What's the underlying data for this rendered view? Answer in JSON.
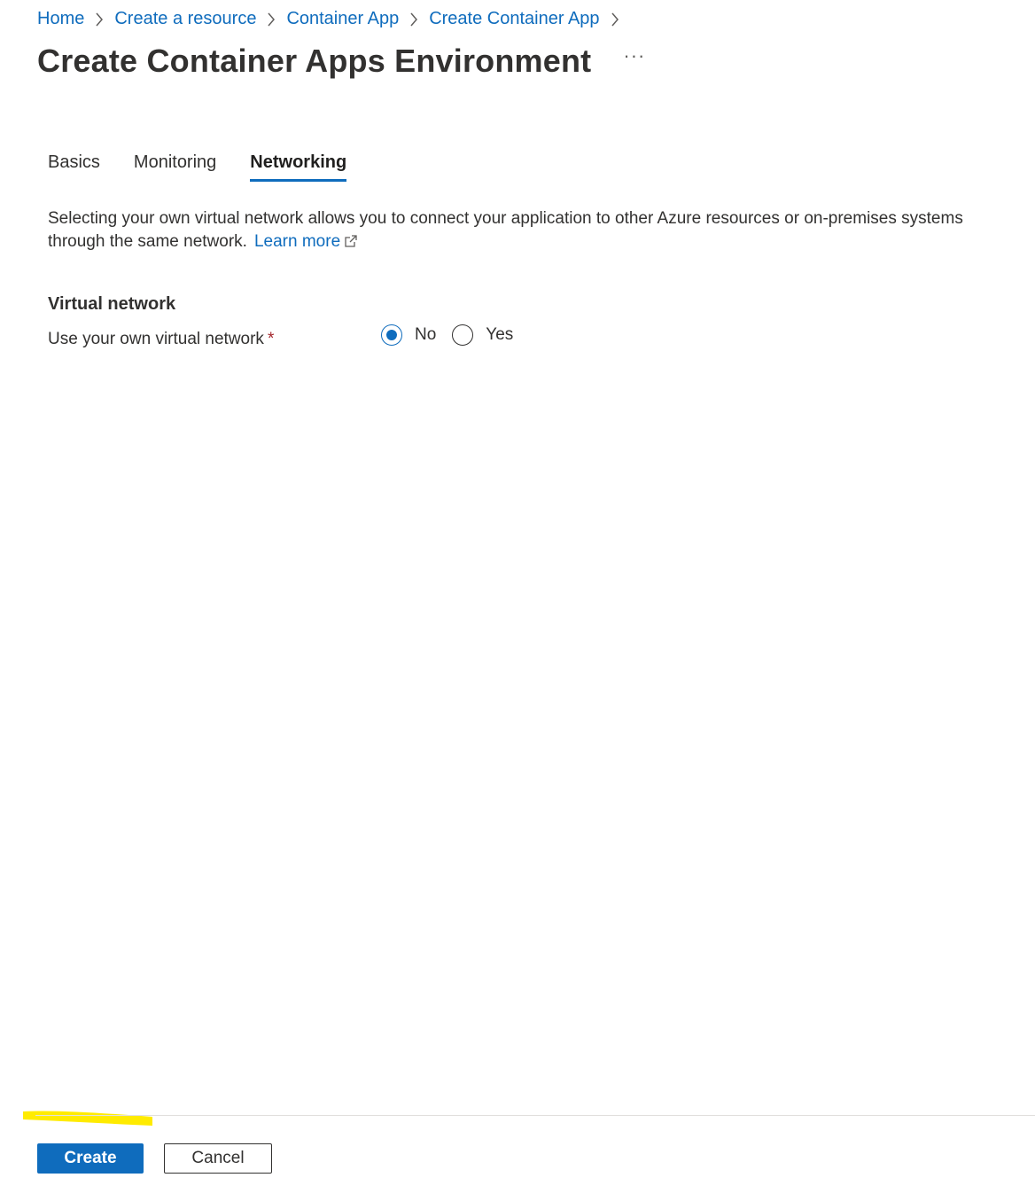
{
  "breadcrumb": {
    "items": [
      {
        "label": "Home"
      },
      {
        "label": "Create a resource"
      },
      {
        "label": "Container App"
      },
      {
        "label": "Create Container App"
      }
    ]
  },
  "header": {
    "title": "Create Container Apps Environment",
    "more_label": "···"
  },
  "tabs": [
    {
      "label": "Basics",
      "active": false
    },
    {
      "label": "Monitoring",
      "active": false
    },
    {
      "label": "Networking",
      "active": true
    }
  ],
  "networking": {
    "description": "Selecting your own virtual network allows you to connect your application to other Azure resources or on-premises systems through the same network.",
    "learn_more_label": "Learn more",
    "section_heading": "Virtual network",
    "field_label": "Use your own virtual network",
    "required_marker": "*",
    "options": [
      {
        "label": "No",
        "selected": true
      },
      {
        "label": "Yes",
        "selected": false
      }
    ]
  },
  "footer": {
    "create_label": "Create",
    "cancel_label": "Cancel"
  },
  "colors": {
    "accent": "#0f6cbd",
    "required": "#a4262c",
    "highlight": "#ffeb00"
  }
}
